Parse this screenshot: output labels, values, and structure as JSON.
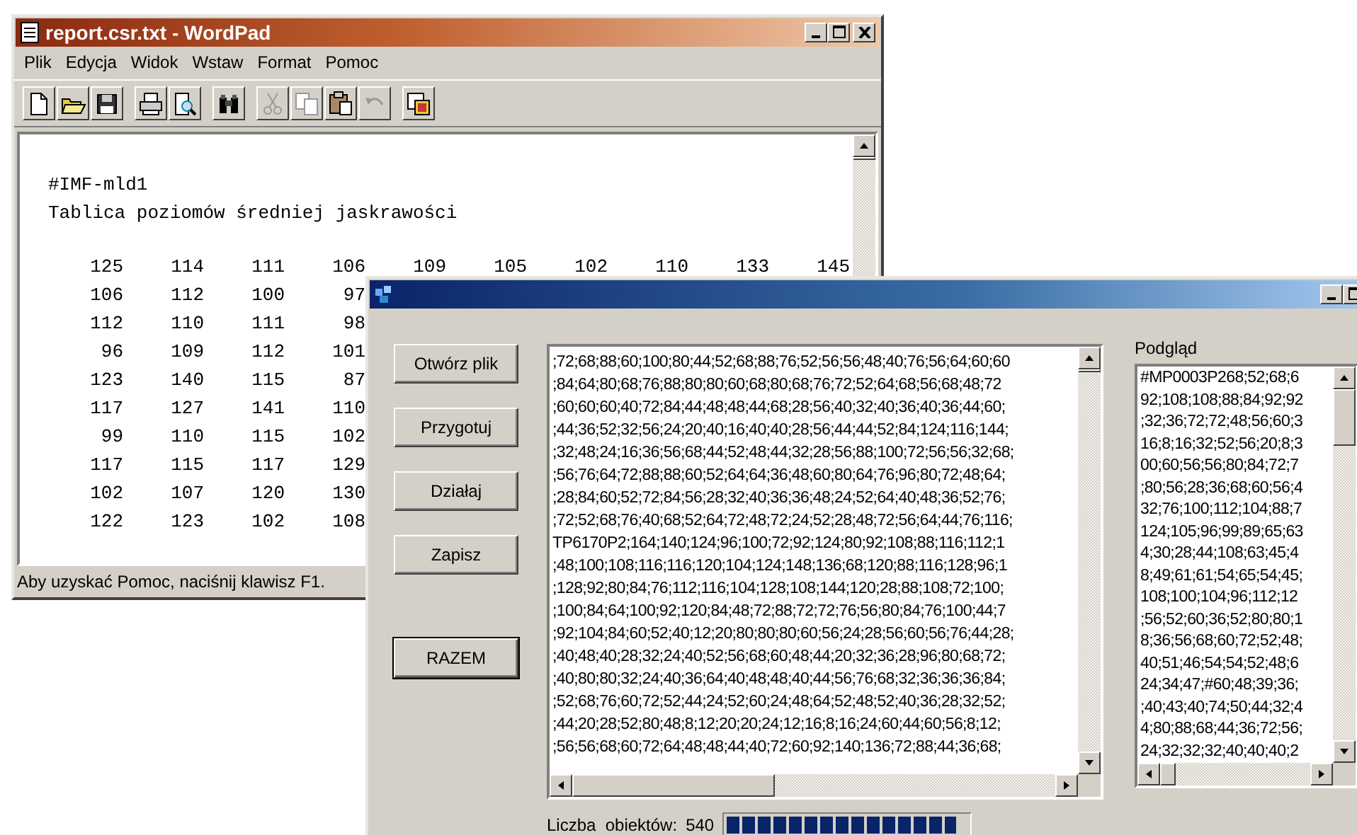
{
  "wordpad": {
    "title": "report.csr.txt - WordPad",
    "menu": [
      "Plik",
      "Edycja",
      "Widok",
      "Wstaw",
      "Format",
      "Pomoc"
    ],
    "toolbar": [
      {
        "buttons": [
          {
            "kind": "new",
            "disabled": false
          },
          {
            "kind": "open",
            "disabled": false
          },
          {
            "kind": "save",
            "disabled": false
          }
        ]
      },
      {
        "buttons": [
          {
            "kind": "print",
            "disabled": false
          },
          {
            "kind": "preview",
            "disabled": false
          }
        ]
      },
      {
        "buttons": [
          {
            "kind": "find",
            "disabled": false
          }
        ]
      },
      {
        "buttons": [
          {
            "kind": "cut",
            "disabled": true
          },
          {
            "kind": "copy",
            "disabled": true
          },
          {
            "kind": "paste",
            "disabled": false
          },
          {
            "kind": "undo",
            "disabled": true
          }
        ]
      },
      {
        "buttons": [
          {
            "kind": "object",
            "disabled": false
          }
        ]
      }
    ],
    "document": {
      "lines": [
        "#IMF-mld1",
        "Tablica poziomów średniej jaskrawości"
      ],
      "table": [
        [
          "125",
          "114",
          "111",
          "106",
          "109",
          "105",
          "102",
          "110",
          "133",
          "145"
        ],
        [
          "106",
          "112",
          "100",
          "97"
        ],
        [
          "112",
          "110",
          "111",
          "98"
        ],
        [
          "96",
          "109",
          "112",
          "101"
        ],
        [
          "123",
          "140",
          "115",
          "87"
        ],
        [
          "117",
          "127",
          "141",
          "110"
        ],
        [
          "99",
          "110",
          "115",
          "102"
        ],
        [
          "117",
          "115",
          "117",
          "129"
        ],
        [
          "102",
          "107",
          "120",
          "130"
        ],
        [
          "122",
          "123",
          "102",
          "108"
        ]
      ]
    },
    "status_bar": "Aby uzyskać Pomoc, naciśnij klawisz F1."
  },
  "dialog": {
    "buttons": [
      {
        "label": "Otwórz plik",
        "default": false
      },
      {
        "label": "Przygotuj",
        "default": false
      },
      {
        "label": "Działaj",
        "default": false
      },
      {
        "label": "Zapisz",
        "default": false
      },
      {
        "label": "RAZEM",
        "default": true
      }
    ],
    "data_list": {
      "lines": [
        ";72;68;88;60;100;80;44;52;68;88;76;52;56;56;48;40;76;56;64;60;60",
        ";84;64;80;68;76;88;80;80;60;68;80;68;76;72;52;64;68;56;68;48;72",
        ";60;60;60;40;72;84;44;48;48;44;68;28;56;40;32;40;36;40;36;44;60;",
        ";44;36;52;32;56;24;20;40;16;40;40;28;56;44;44;52;84;124;116;144;",
        ";32;48;24;16;36;56;68;44;52;48;44;32;28;56;88;100;72;56;56;32;68;",
        ";56;76;64;72;88;88;60;52;64;64;36;48;60;80;64;76;96;80;72;48;64;",
        ";28;84;60;52;72;84;56;28;32;40;36;36;48;24;52;64;40;48;36;52;76;",
        ";72;52;68;76;40;68;52;64;72;48;72;24;52;28;48;72;56;64;44;76;116;",
        "TP6170P2;164;140;124;96;100;72;92;124;80;92;108;88;116;112;1",
        ";48;100;108;116;116;120;104;124;148;136;68;120;88;116;128;96;1",
        ";128;92;80;84;76;112;116;104;128;108;144;120;28;88;108;72;100;",
        ";100;84;64;100;92;120;84;48;72;88;72;72;76;56;80;84;76;100;44;7",
        ";92;104;84;60;52;40;12;20;80;80;80;60;56;24;28;56;60;56;76;44;28;",
        ";40;48;40;28;32;24;40;52;56;68;60;48;44;20;32;36;28;96;80;68;72;",
        ";40;80;80;32;24;40;36;64;40;48;48;40;44;56;76;68;32;36;36;36;84;",
        ";52;68;76;60;72;52;44;24;52;60;24;48;64;52;48;52;40;36;28;32;52;",
        ";44;20;28;52;80;48;8;12;20;20;24;12;16;8;16;24;60;44;60;56;8;12;",
        ";56;56;68;60;72;64;48;48;44;40;72;60;92;140;136;72;88;44;36;68;"
      ]
    },
    "preview": {
      "label": "Podgląd",
      "lines": [
        "#MP0003P268;52;68;6",
        "92;108;108;88;84;92;92",
        ";32;36;72;72;48;56;60;3",
        "16;8;16;32;52;56;20;8;3",
        "00;60;56;56;80;84;72;7",
        ";80;56;28;36;68;60;56;4",
        "32;76;100;112;104;88;7",
        "124;105;96;99;89;65;63",
        "4;30;28;44;108;63;45;4",
        "8;49;61;61;54;65;54;45;",
        "108;100;104;96;112;12",
        ";56;52;60;36;52;80;80;1",
        "8;36;56;68;60;72;52;48;",
        "40;51;46;54;54;52;48;6",
        "24;34;47;#60;48;39;36;",
        ";40;43;40;74;50;44;32;4",
        "4;80;88;68;44;36;72;56;",
        "24;32;32;32;40;40;40;2"
      ]
    },
    "count_label": "Liczba  obiektów:",
    "count": "540",
    "progress": {
      "level": 0.95
    }
  }
}
